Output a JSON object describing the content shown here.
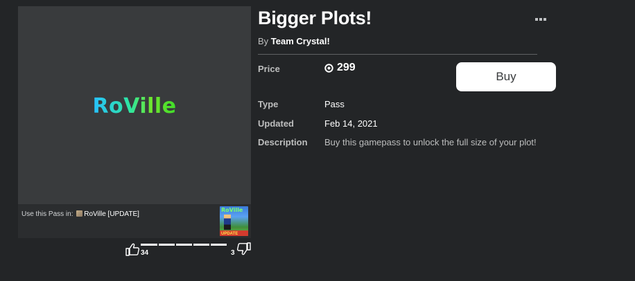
{
  "item": {
    "title": "Bigger Plots!",
    "by_prefix": "By",
    "creator": "Team Crystal!",
    "price_label": "Price",
    "price_value": "299",
    "currency_icon": "robux-icon",
    "buy_label": "Buy",
    "type_label": "Type",
    "type_value": "Pass",
    "updated_label": "Updated",
    "updated_value": "Feb 14, 2021",
    "description_label": "Description",
    "description_value": "Buy this gamepass to unlock the full size of your plot!"
  },
  "thumbnail": {
    "logo_text": "RoVille",
    "use_pass_prefix": "Use this Pass in:",
    "game_name": "RoVille [UPDATE]",
    "game_thumb_title": "RoVille",
    "game_thumb_banner": "UPDATE"
  },
  "votes": {
    "up": "34",
    "down": "3",
    "up_fraction": 0.92
  },
  "colors": {
    "background": "#232527",
    "card": "#393b3d",
    "buy_button": "#ffffff",
    "muted_text": "#bdbebe"
  }
}
